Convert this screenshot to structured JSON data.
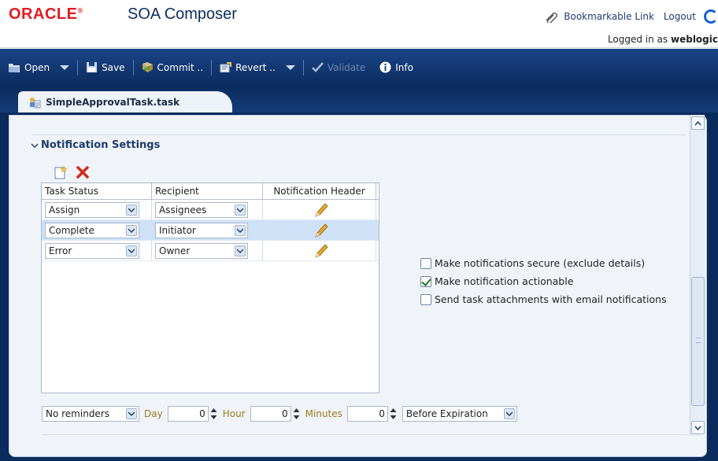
{
  "header": {
    "logo": "ORACLE",
    "product": "SOA Composer",
    "links": {
      "bookmark": "Bookmarkable Link",
      "logout": "Logout"
    },
    "logged_in_prefix": "Logged in as",
    "logged_in_user": "weblogic"
  },
  "toolbar": {
    "open": "Open",
    "save": "Save",
    "commit": "Commit ..",
    "revert": "Revert ..",
    "validate": "Validate",
    "info": "Info"
  },
  "tab": {
    "label": "SimpleApprovalTask.task"
  },
  "section": {
    "title": "Notification Settings",
    "columns": [
      "Task Status",
      "Recipient",
      "Notification Header"
    ],
    "rows": [
      {
        "status": "Assign",
        "recipient": "Assignees",
        "selected": false
      },
      {
        "status": "Complete",
        "recipient": "Initiator",
        "selected": true
      },
      {
        "status": "Error",
        "recipient": "Owner",
        "selected": false
      }
    ],
    "options": [
      {
        "label": "Make notifications secure (exclude details)",
        "checked": false
      },
      {
        "label": "Make notification actionable",
        "checked": true
      },
      {
        "label": "Send task attachments with email notifications",
        "checked": false
      }
    ],
    "reminders": {
      "mode": "No reminders",
      "day_label": "Day",
      "day_value": "0",
      "hour_label": "Hour",
      "hour_value": "0",
      "minutes_label": "Minutes",
      "minutes_value": "0",
      "relative": "Before Expiration"
    }
  },
  "colors": {
    "brand_red": "#e21b23",
    "toolbar_bg": "#0b2b5d",
    "selected_row": "#cfe1f7"
  },
  "icons": [
    "paperclip-icon",
    "folder-open-icon",
    "save-disk-icon",
    "commit-icon",
    "revert-icon",
    "checkmark-icon",
    "info-icon",
    "task-icon",
    "chevron-down-icon",
    "add-row-icon",
    "delete-icon",
    "pencil-icon",
    "dropdown-arrow-icon",
    "spinner-icon",
    "scroll-up-icon",
    "scroll-down-icon"
  ]
}
